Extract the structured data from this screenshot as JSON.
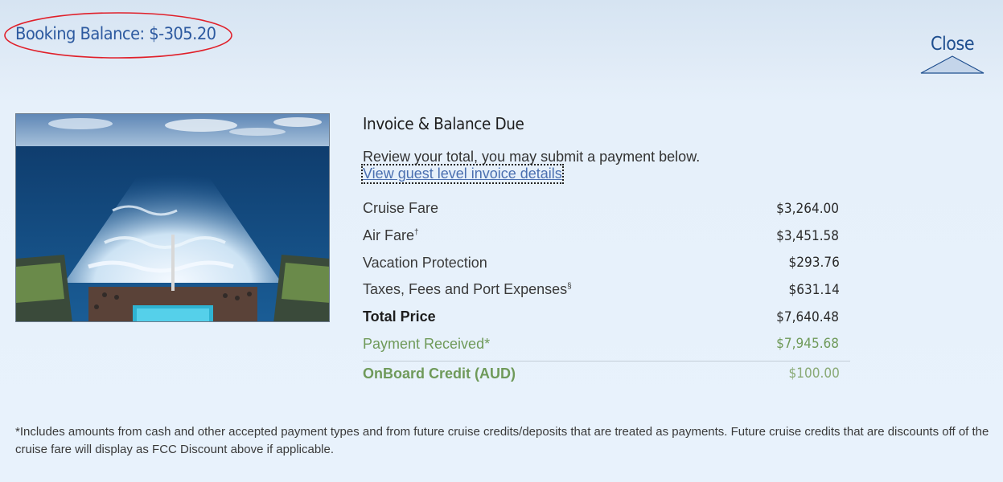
{
  "header": {
    "booking_balance": "Booking Balance: $-305.20",
    "close_label": "Close"
  },
  "image": {
    "subject": "cruise ship wake photo"
  },
  "invoice": {
    "title": "Invoice & Balance Due",
    "intro": "Review your total, you may submit a payment below.",
    "details_link": "View guest level invoice details",
    "items": [
      {
        "label": "Cruise Fare",
        "sup": "",
        "amount": "$3,264.00"
      },
      {
        "label": "Air Fare",
        "sup": "†",
        "amount": "$3,451.58"
      },
      {
        "label": "Vacation Protection",
        "sup": "",
        "amount": "$293.76"
      },
      {
        "label": "Taxes, Fees and Port Expenses",
        "sup": "§",
        "amount": "$631.14"
      }
    ],
    "total": {
      "label": "Total Price",
      "amount": "$7,640.48"
    },
    "payment": {
      "label": "Payment Received*",
      "amount": "$7,945.68"
    },
    "credit": {
      "label": "OnBoard Credit (AUD)",
      "amount": "$100.00"
    }
  },
  "footnote": "*Includes amounts from cash and other accepted payment types and from future cruise credits/deposits that are treated as payments. Future cruise credits that are discounts off of the cruise fare will display as FCC Discount above if applicable.",
  "colors": {
    "accent_blue": "#2d5aa0",
    "paid_green": "#6f9a5a",
    "annotation_red": "#e0202a"
  }
}
